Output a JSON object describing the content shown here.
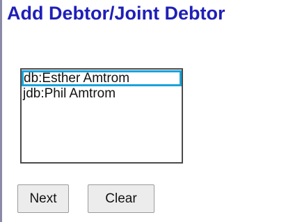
{
  "header": {
    "title": "Add Debtor/Joint Debtor"
  },
  "debtor_list": {
    "options": [
      {
        "label": "db:Esther Amtrom",
        "selected": true
      },
      {
        "label": "jdb:Phil Amtrom",
        "selected": false
      }
    ]
  },
  "actions": {
    "next_label": "Next",
    "clear_label": "Clear"
  },
  "colors": {
    "title": "#1f1fb8",
    "selection_outline": "#1aa3d9"
  }
}
